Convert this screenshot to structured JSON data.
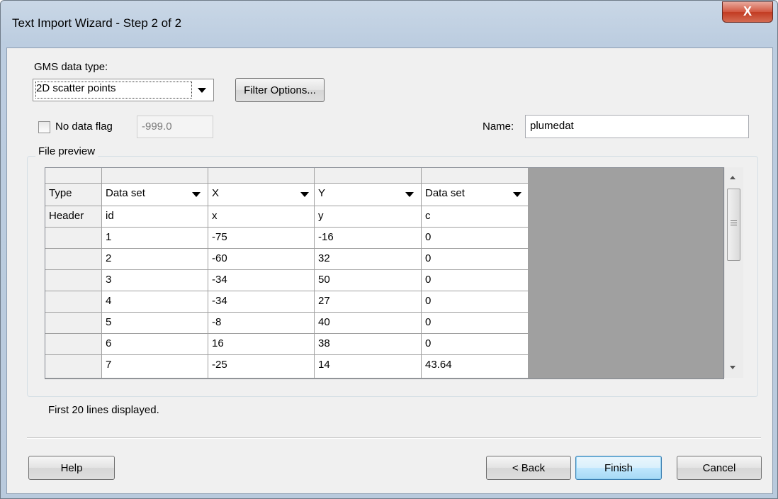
{
  "window": {
    "title": "Text Import Wizard - Step 2 of 2",
    "close_glyph": "X"
  },
  "data_type": {
    "label": "GMS data type:",
    "value": "2D scatter points"
  },
  "filter_button": "Filter Options...",
  "no_data_flag": {
    "label": "No data flag",
    "checked": false,
    "value": "-999.0"
  },
  "name": {
    "label": "Name:",
    "value": "plumedat"
  },
  "file_preview": {
    "label": "File preview",
    "type_row": {
      "label": "Type",
      "values": [
        "Data set",
        "X",
        "Y",
        "Data set"
      ]
    },
    "header_row": {
      "label": "Header",
      "values": [
        "id",
        "x",
        "y",
        "c"
      ]
    },
    "rows": [
      [
        "1",
        "-75",
        "-16",
        "0"
      ],
      [
        "2",
        "-60",
        "32",
        "0"
      ],
      [
        "3",
        "-34",
        "50",
        "0"
      ],
      [
        "4",
        "-34",
        "27",
        "0"
      ],
      [
        "5",
        "-8",
        "40",
        "0"
      ],
      [
        "6",
        "16",
        "38",
        "0"
      ],
      [
        "7",
        "-25",
        "14",
        "43.64"
      ]
    ],
    "status": "First 20 lines displayed."
  },
  "buttons": {
    "help": "Help",
    "back": "< Back",
    "finish": "Finish",
    "cancel": "Cancel"
  }
}
